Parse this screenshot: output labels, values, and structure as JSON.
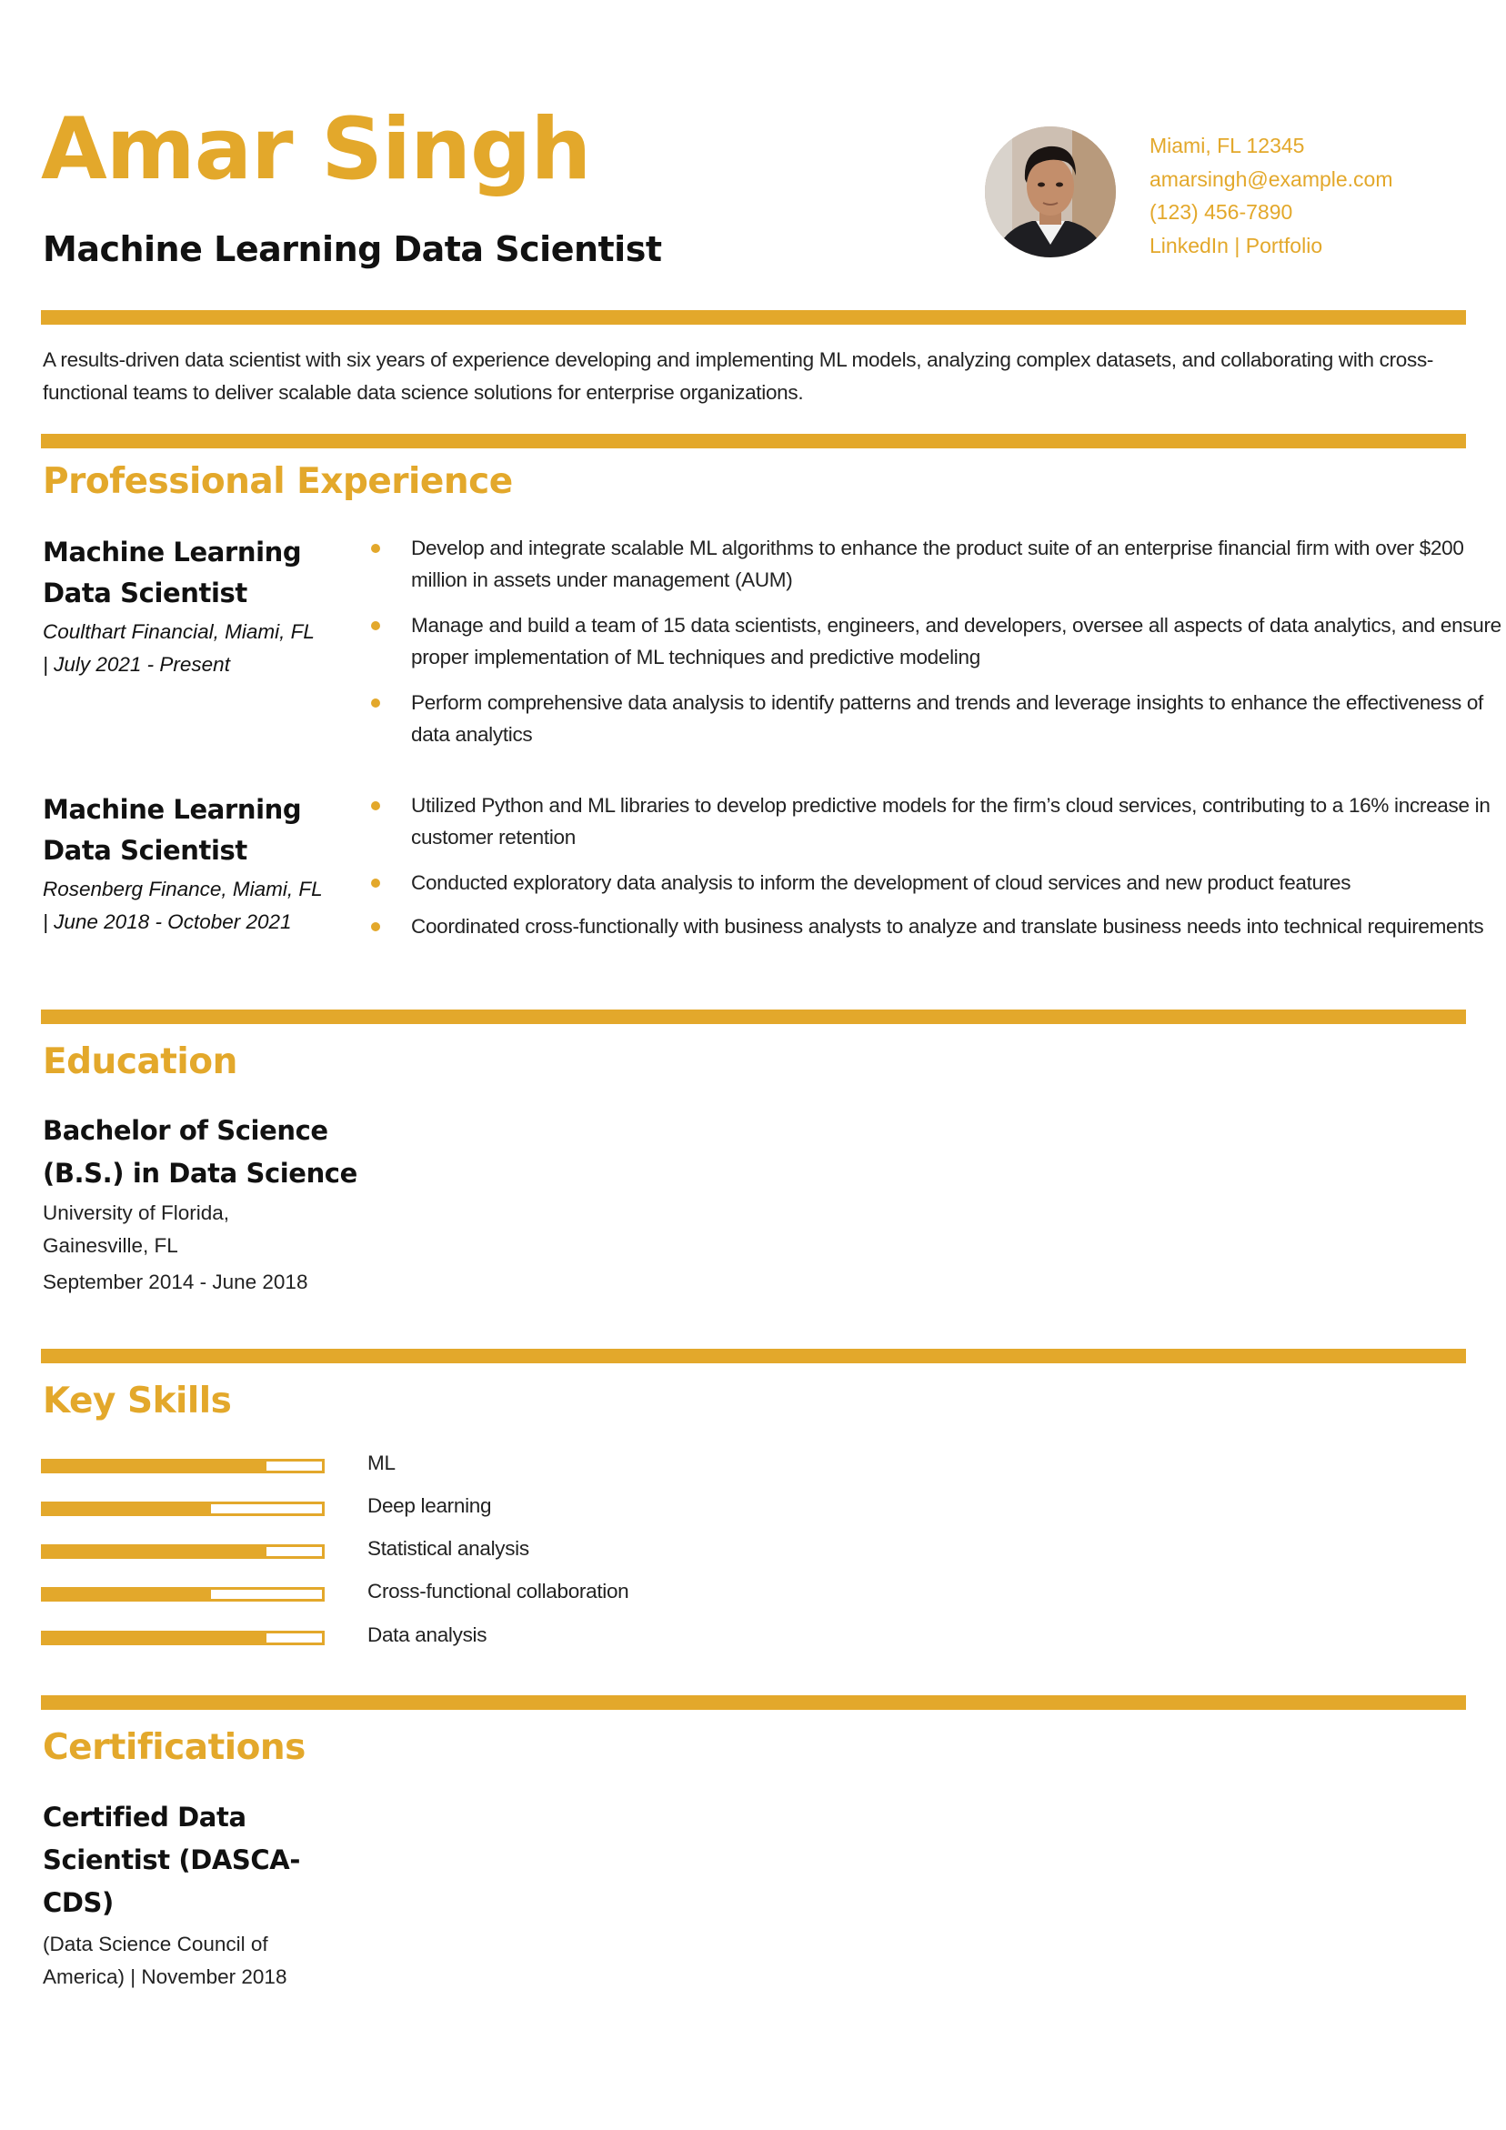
{
  "colors": {
    "accent": "#E3A82B",
    "text": "#111111"
  },
  "header": {
    "name": "Amar Singh",
    "title": "Machine Learning Data Scientist",
    "photo_alt": "profile-photo",
    "contact": {
      "location": "Miami, FL 12345",
      "email": "amarsingh@example.com",
      "phone": "(123) 456-7890",
      "linkedin": "LinkedIn",
      "separator": " | ",
      "portfolio": "Portfolio"
    }
  },
  "summary": "A results-driven data scientist with six years of experience developing and implementing ML models, analyzing complex datasets, and collaborating with cross-functional teams to deliver scalable data science solutions for enterprise organizations.",
  "experience": {
    "heading": "Professional Experience",
    "jobs": [
      {
        "title_line1": "Machine Learning",
        "title_line2": "Data Scientist",
        "company": "Coulthart Financial, Miami, FL",
        "dates": "| July 2021 - Present",
        "bullets": [
          "Develop and integrate scalable ML algorithms to enhance the product suite of an enterprise financial firm with over $200 million in assets under management (AUM)",
          "Manage and build a team of 15 data scientists, engineers, and developers, oversee all aspects of data analytics, and ensure proper implementation of ML techniques and predictive modeling",
          "Perform comprehensive data analysis to identify patterns and trends and leverage insights to enhance the effectiveness of data analytics"
        ]
      },
      {
        "title_line1": "Machine Learning",
        "title_line2": "Data Scientist",
        "company": "Rosenberg Finance, Miami, FL",
        "dates": "| June 2018 - October 2021",
        "bullets": [
          "Utilized Python and ML libraries to develop predictive models for the firm’s cloud services, contributing to a 16% increase in customer retention",
          "Conducted exploratory data analysis to inform the development of cloud services and new product features",
          "Coordinated cross-functionally with business analysts to analyze and translate business needs into technical requirements"
        ]
      }
    ]
  },
  "education": {
    "heading": "Education",
    "degree_line1": "Bachelor of Science",
    "degree_line2": "(B.S.) in Data Science",
    "school_line1": "University of Florida,",
    "school_line2": "Gainesville, FL",
    "dates": "September 2014 - June 2018"
  },
  "skills": {
    "heading": "Key Skills",
    "items": [
      {
        "label": "ML",
        "level": 0.8
      },
      {
        "label": "Deep learning",
        "level": 0.6
      },
      {
        "label": "Statistical analysis",
        "level": 0.8
      },
      {
        "label": "Cross-functional collaboration",
        "level": 0.6
      },
      {
        "label": "Data analysis",
        "level": 0.8
      }
    ]
  },
  "certifications": {
    "heading": "Certifications",
    "name_line1": "Certified Data",
    "name_line2": "Scientist (DASCA-",
    "name_line3": "CDS)",
    "issuer_line1": "(Data Science Council of",
    "issuer_line2": "America) | November 2018"
  }
}
